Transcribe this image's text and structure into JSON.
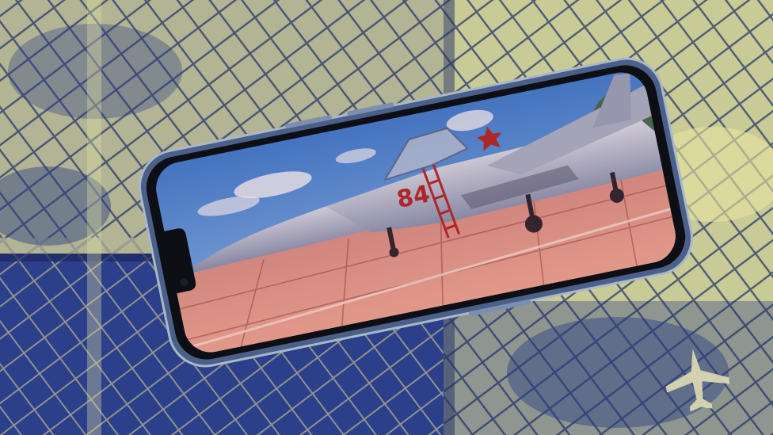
{
  "image": {
    "description_free": true,
    "colors": {
      "navy": "#2b3d86",
      "cream": "#e9e5a8",
      "olive": "#8f9a6a",
      "sky": "#4c8fe0",
      "tarmac": "#e79a8c",
      "jet_body": "#c9d3e4",
      "red_accent": "#b4282a"
    },
    "jet_number": "84"
  }
}
